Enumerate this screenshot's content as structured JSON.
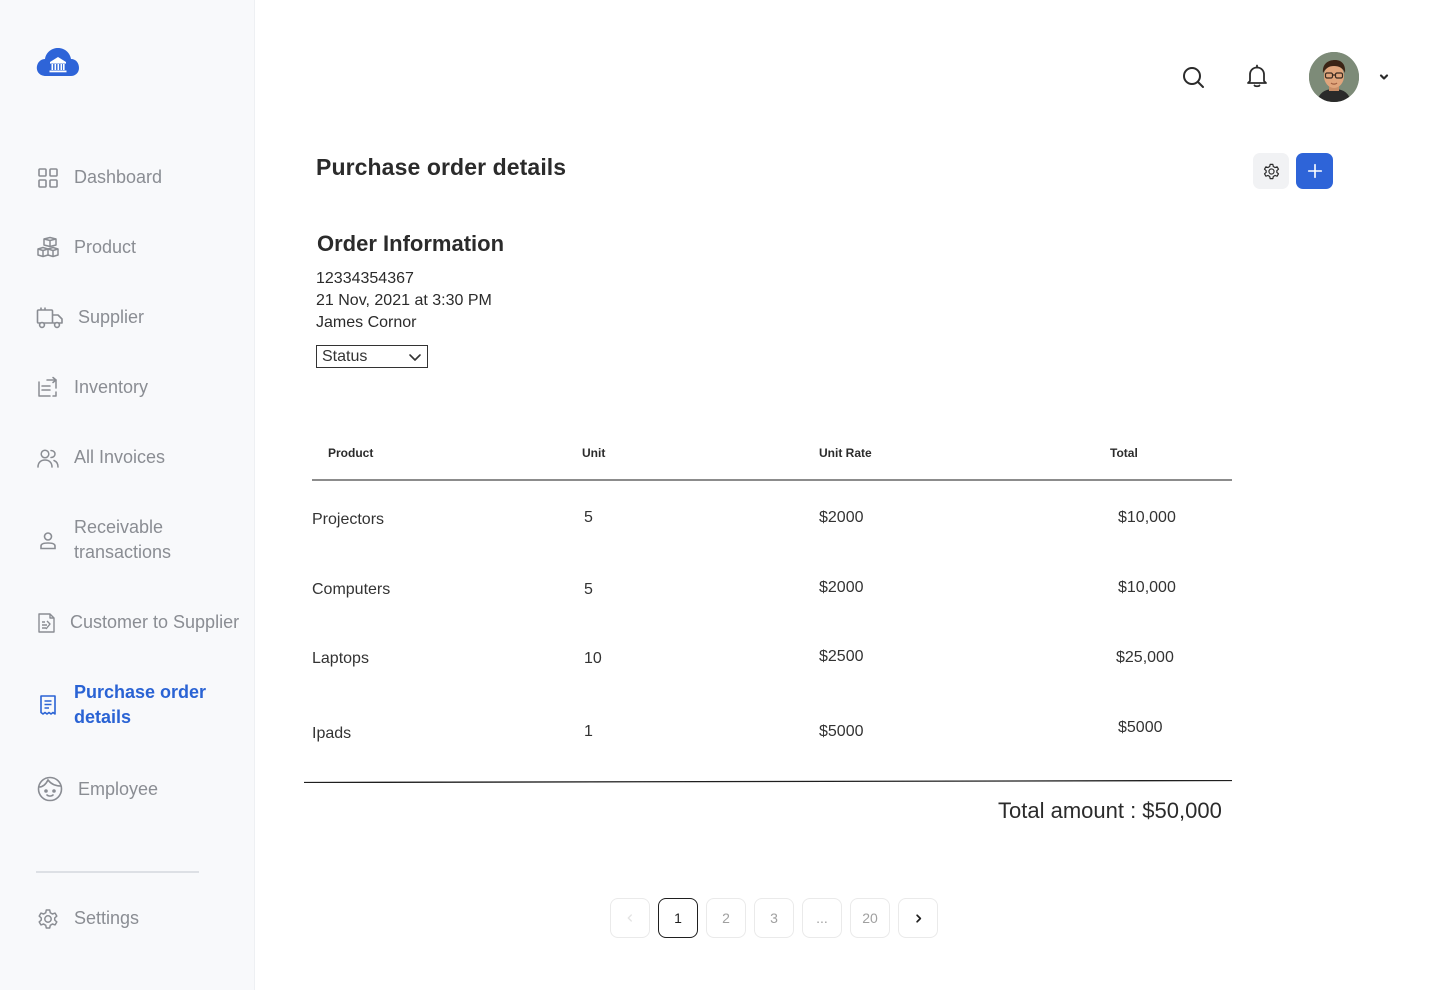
{
  "sidebar": {
    "items": [
      {
        "label": "Dashboard",
        "icon": "grid-icon"
      },
      {
        "label": "Product",
        "icon": "boxes-icon"
      },
      {
        "label": "Supplier",
        "icon": "truck-icon"
      },
      {
        "label": "Inventory",
        "icon": "inventory-icon"
      },
      {
        "label": "All Invoices",
        "icon": "users-icon"
      },
      {
        "label": "Receivable transactions",
        "icon": "person-icon"
      },
      {
        "label": "Customer to Supplier",
        "icon": "document-icon"
      },
      {
        "label": "Purchase order details",
        "icon": "receipt-icon",
        "active": true
      },
      {
        "label": "Employee",
        "icon": "face-icon"
      }
    ],
    "settings_label": "Settings"
  },
  "header": {
    "icons": [
      "search-icon",
      "bell-icon",
      "avatar",
      "chevron-down-icon"
    ]
  },
  "page": {
    "title": "Purchase order details"
  },
  "order": {
    "section_title": "Order Information",
    "number": "12334354367",
    "date": "21 Nov, 2021 at 3:30 PM",
    "name": "James Cornor",
    "status_label": "Status"
  },
  "table": {
    "headers": [
      "Product",
      "Unit",
      "Unit Rate",
      "Total"
    ],
    "rows": [
      [
        "Projectors",
        "5",
        "$2000",
        "$10,000"
      ],
      [
        "Computers",
        "5",
        "$2000",
        "$10,000"
      ],
      [
        "Laptops",
        "10",
        "$2500",
        "$25,000"
      ],
      [
        "Ipads",
        "1",
        "$5000",
        "$5000"
      ]
    ]
  },
  "total": {
    "label": "Total amount : $50,000"
  },
  "pagination": {
    "pages": [
      "1",
      "2",
      "3",
      "...",
      "20"
    ],
    "current": "1"
  },
  "colors": {
    "accent": "#2e64d8",
    "active_nav": "#2a63d4",
    "muted_text": "#8a8d93"
  }
}
